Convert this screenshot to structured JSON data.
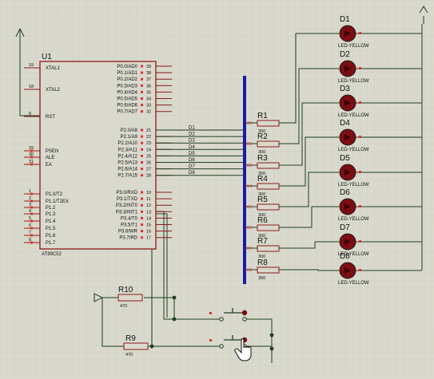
{
  "schematic": {
    "mcu": {
      "ref": "U1",
      "part": "AT89C52",
      "left_pins": [
        {
          "num": "19",
          "name": "XTAL1"
        },
        {
          "num": "18",
          "name": "XTAL2"
        },
        {
          "num": "9",
          "name": "RST"
        },
        {
          "num": "29",
          "name": "PSEN"
        },
        {
          "num": "30",
          "name": "ALE"
        },
        {
          "num": "31",
          "name": "EA"
        },
        {
          "num": "1",
          "name": "P1.0/T2"
        },
        {
          "num": "2",
          "name": "P1.1/T2EX"
        },
        {
          "num": "3",
          "name": "P1.2"
        },
        {
          "num": "4",
          "name": "P1.3"
        },
        {
          "num": "5",
          "name": "P1.4"
        },
        {
          "num": "6",
          "name": "P1.5"
        },
        {
          "num": "7",
          "name": "P1.6"
        },
        {
          "num": "8",
          "name": "P1.7"
        }
      ],
      "right_pins": [
        {
          "num": "39",
          "name": "P0.0/AD0"
        },
        {
          "num": "38",
          "name": "P0.1/AD1"
        },
        {
          "num": "37",
          "name": "P0.2/AD2"
        },
        {
          "num": "36",
          "name": "P0.3/AD3"
        },
        {
          "num": "35",
          "name": "P0.4/AD4"
        },
        {
          "num": "34",
          "name": "P0.5/AD5"
        },
        {
          "num": "33",
          "name": "P0.6/AD6"
        },
        {
          "num": "32",
          "name": "P0.7/AD7"
        },
        {
          "num": "21",
          "name": "P2.0/A8"
        },
        {
          "num": "22",
          "name": "P2.1/A9"
        },
        {
          "num": "23",
          "name": "P2.2/A10"
        },
        {
          "num": "24",
          "name": "P2.3/A11"
        },
        {
          "num": "25",
          "name": "P2.4/A12"
        },
        {
          "num": "26",
          "name": "P2.5/A13"
        },
        {
          "num": "27",
          "name": "P2.6/A14"
        },
        {
          "num": "28",
          "name": "P2.7/A15"
        },
        {
          "num": "10",
          "name": "P3.0/RXD"
        },
        {
          "num": "11",
          "name": "P3.1/TXD"
        },
        {
          "num": "12",
          "name": "P3.2/INT0"
        },
        {
          "num": "13",
          "name": "P3.3/INT1"
        },
        {
          "num": "14",
          "name": "P3.4/T0"
        },
        {
          "num": "15",
          "name": "P3.5/T1"
        },
        {
          "num": "16",
          "name": "P3.6/WR"
        },
        {
          "num": "17",
          "name": "P3.7/RD"
        }
      ]
    },
    "net_labels": [
      "D1",
      "D2",
      "D3",
      "D4",
      "D5",
      "D6",
      "D7",
      "D8"
    ],
    "resistors": [
      {
        "ref": "R1",
        "value": "300"
      },
      {
        "ref": "R2",
        "value": "300"
      },
      {
        "ref": "R3",
        "value": "300"
      },
      {
        "ref": "R4",
        "value": "300"
      },
      {
        "ref": "R5",
        "value": "300"
      },
      {
        "ref": "R6",
        "value": "300"
      },
      {
        "ref": "R7",
        "value": "300"
      },
      {
        "ref": "R8",
        "value": "300"
      }
    ],
    "bus_labels": [
      "D1",
      "D2",
      "D3",
      "D4",
      "D5",
      "D6",
      "D7",
      "D8"
    ],
    "leds": [
      {
        "ref": "D1",
        "part": "LED-YELLOW"
      },
      {
        "ref": "D2",
        "part": "LED-YELLOW"
      },
      {
        "ref": "D3",
        "part": "LED-YELLOW"
      },
      {
        "ref": "D4",
        "part": "LED-YELLOW"
      },
      {
        "ref": "D5",
        "part": "LED-YELLOW"
      },
      {
        "ref": "D6",
        "part": "LED-YELLOW"
      },
      {
        "ref": "D7",
        "part": "LED-YELLOW"
      },
      {
        "ref": "D8",
        "part": "LED-YELLOW"
      }
    ],
    "pullups": [
      {
        "ref": "R10",
        "value": "470"
      },
      {
        "ref": "R9",
        "value": "470"
      }
    ],
    "colors": {
      "background": "#d9d9cd",
      "grid": "#c6c6b8",
      "component": "#8b1a1a",
      "wire": "#1f3f1f",
      "bus": "#1a1aa8",
      "led_body": "#7a0e12",
      "pin_marker": "#e03030",
      "text": "#111111"
    }
  }
}
